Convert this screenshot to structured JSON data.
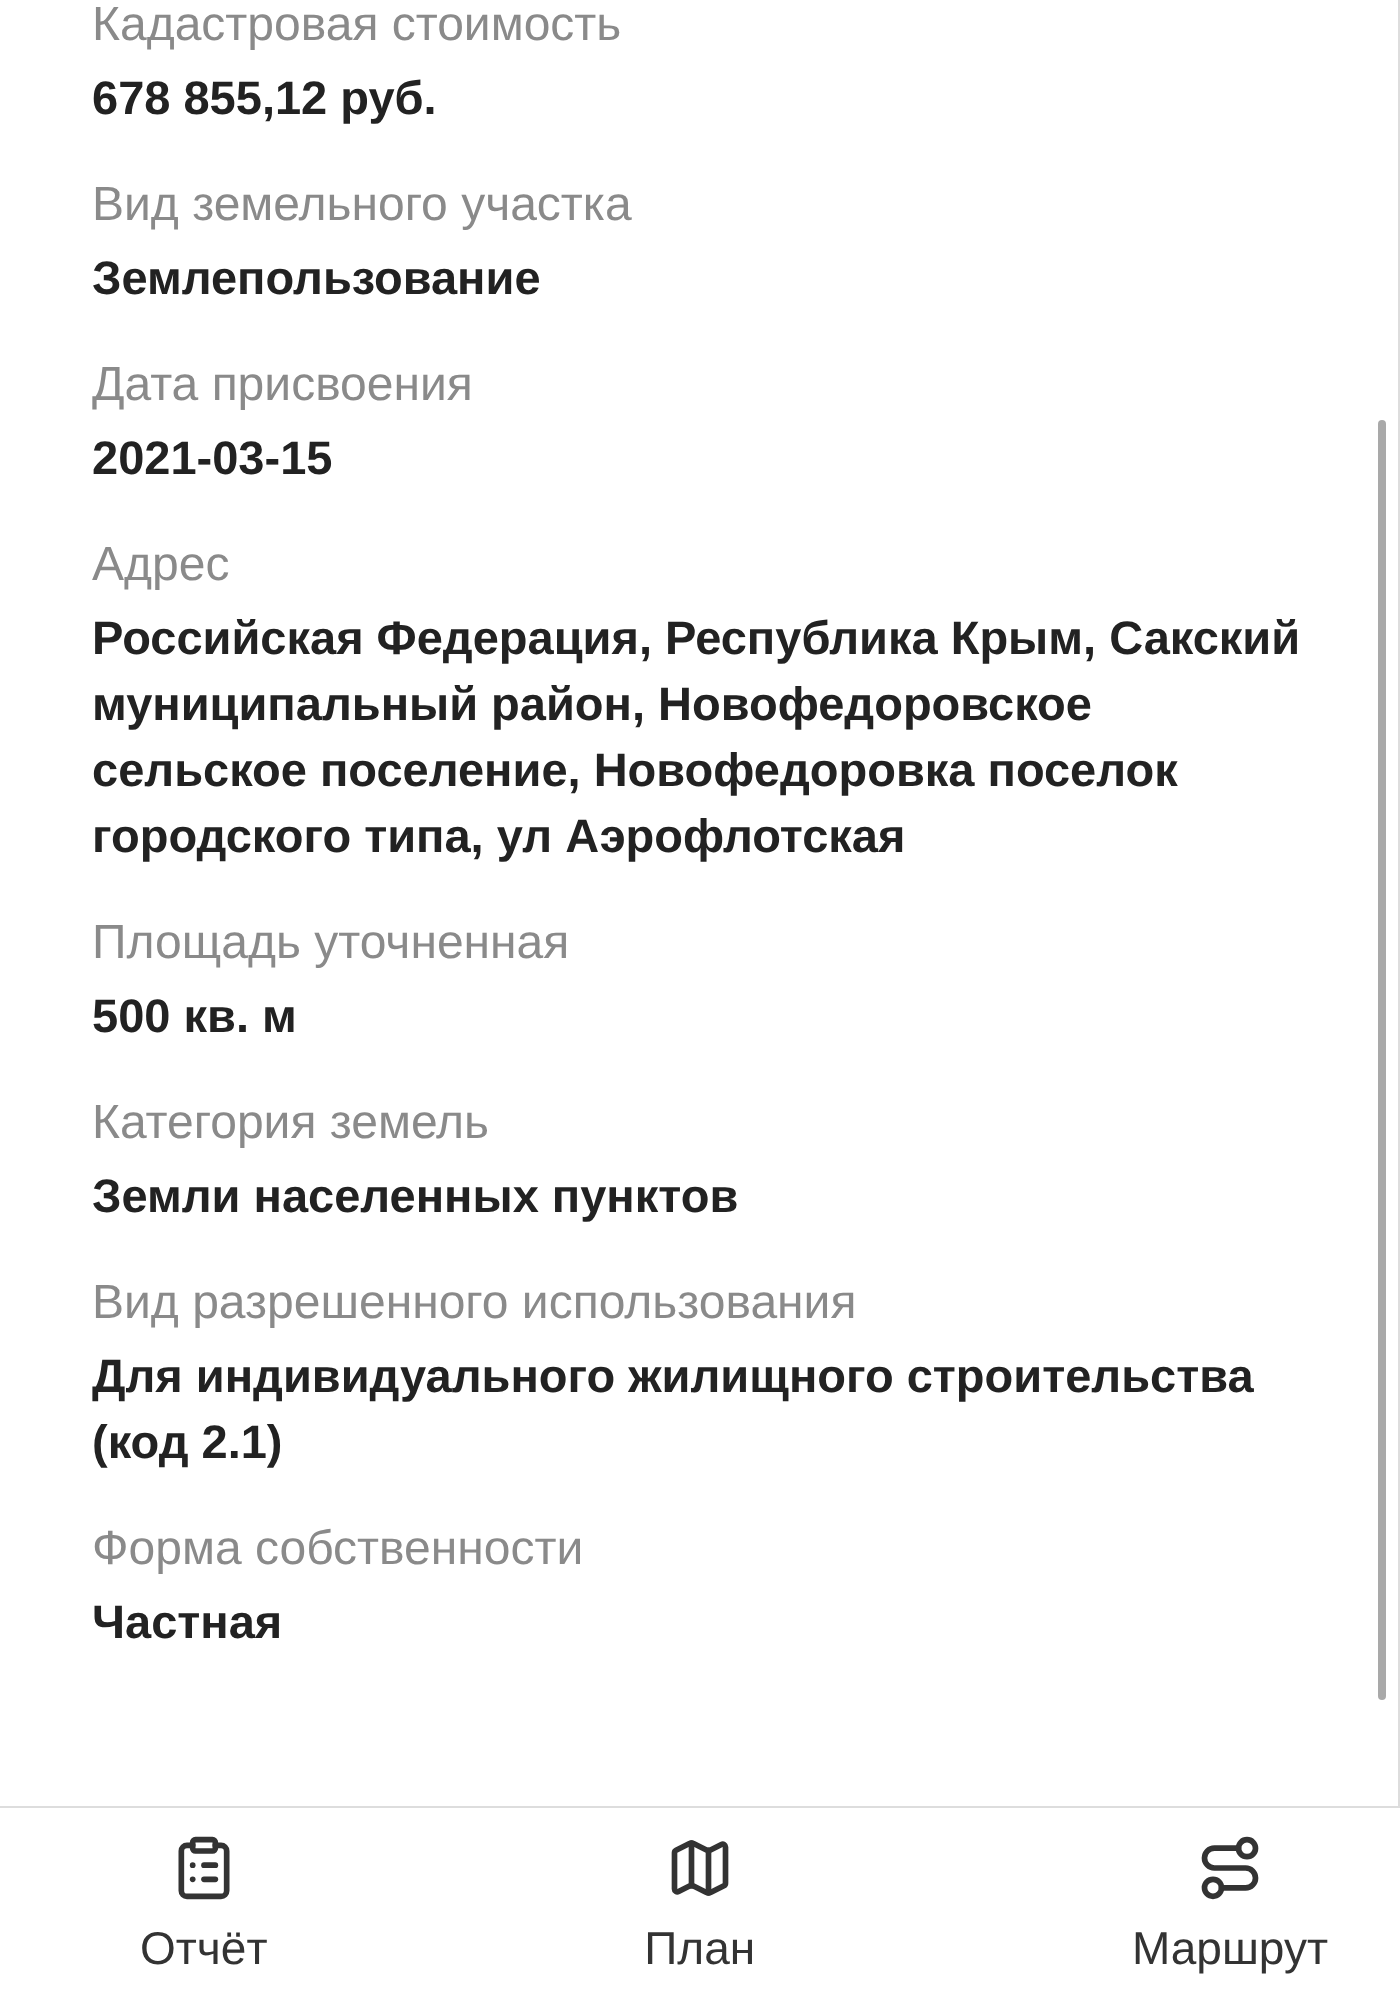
{
  "fields": [
    {
      "label": "Кадастровая стоимость",
      "value": "678 855,12 руб."
    },
    {
      "label": "Вид земельного участка",
      "value": "Землепользование"
    },
    {
      "label": "Дата присвоения",
      "value": "2021-03-15"
    },
    {
      "label": "Адрес",
      "value": "Российская Федерация, Республика Крым, Сакский муниципальный район, Новофедоровское сельское поселение, Новофедоровка поселок городского типа, ул Аэрофлотская"
    },
    {
      "label": "Площадь уточненная",
      "value": "500 кв. м"
    },
    {
      "label": "Категория земель",
      "value": "Земли населенных пунктов"
    },
    {
      "label": "Вид разрешенного использования",
      "value": "Для индивидуального жилищного строительства (код 2.1)"
    },
    {
      "label": "Форма собственности",
      "value": "Частная"
    }
  ],
  "bottom_nav": [
    {
      "kind": "report",
      "label": "Отчёт"
    },
    {
      "kind": "map",
      "label": "План"
    },
    {
      "kind": "route",
      "label": "Маршрут"
    }
  ]
}
